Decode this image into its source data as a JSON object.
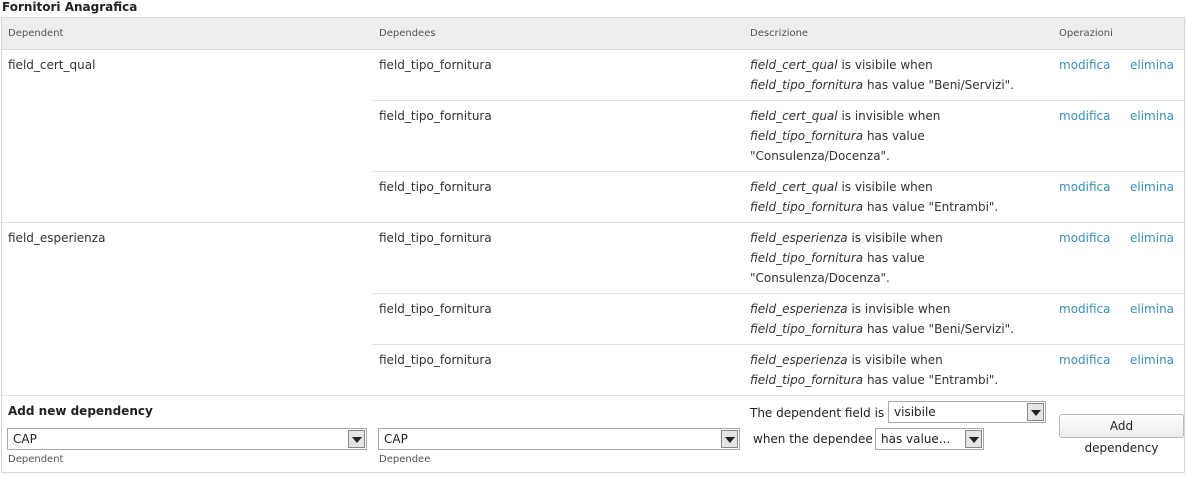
{
  "caption": "Fornitori Anagrafica",
  "headers": {
    "dependent": "Dependent",
    "dependees": "Dependees",
    "descrizione": "Descrizione",
    "operazioni": "Operazioni"
  },
  "links": {
    "edit": "modifica",
    "delete": "elimina"
  },
  "rows": [
    {
      "dependent": "field_cert_qual",
      "dependee": "field_tipo_fornitura",
      "desc": {
        "field": "field_cert_qual",
        "state": " is visibile when",
        "dependee": "field_tipo_fornitura",
        "value_text": " has value \"Beni/Servizi\"."
      }
    },
    {
      "dependent": "",
      "dependee": "field_tipo_fornitura",
      "desc": {
        "field": "field_cert_qual",
        "state": " is invisible when",
        "dependee": "field_tipo_fornitura",
        "value_text": " has value",
        "value_line3": "\"Consulenza/Docenza\"."
      }
    },
    {
      "dependent": "",
      "dependee": "field_tipo_fornitura",
      "desc": {
        "field": "field_cert_qual",
        "state": " is visibile when",
        "dependee": "field_tipo_fornitura",
        "value_text": " has value \"Entrambi\"."
      }
    },
    {
      "dependent": "field_esperienza",
      "dependee": "field_tipo_fornitura",
      "desc": {
        "field": "field_esperienza",
        "state": " is visibile when",
        "dependee": "field_tipo_fornitura",
        "value_text": " has value",
        "value_line3": "\"Consulenza/Docenza\"."
      }
    },
    {
      "dependent": "",
      "dependee": "field_tipo_fornitura",
      "desc": {
        "field": "field_esperienza",
        "state": " is invisible when",
        "dependee": "field_tipo_fornitura",
        "value_text": " has value \"Beni/Servizi\"."
      }
    },
    {
      "dependent": "",
      "dependee": "field_tipo_fornitura",
      "desc": {
        "field": "field_esperienza",
        "state": " is visibile when",
        "dependee": "field_tipo_fornitura",
        "value_text": " has value \"Entrambi\"."
      }
    }
  ],
  "add_form": {
    "title": "Add new dependency",
    "dependent_select": "CAP",
    "dependent_label": "Dependent",
    "dependee_select": "CAP",
    "dependee_label": "Dependee",
    "state_prefix": "The dependent field is",
    "state_select": "visibile",
    "condition_prefix": "when the dependee",
    "condition_select": "has value...",
    "button": "Add dependency"
  }
}
